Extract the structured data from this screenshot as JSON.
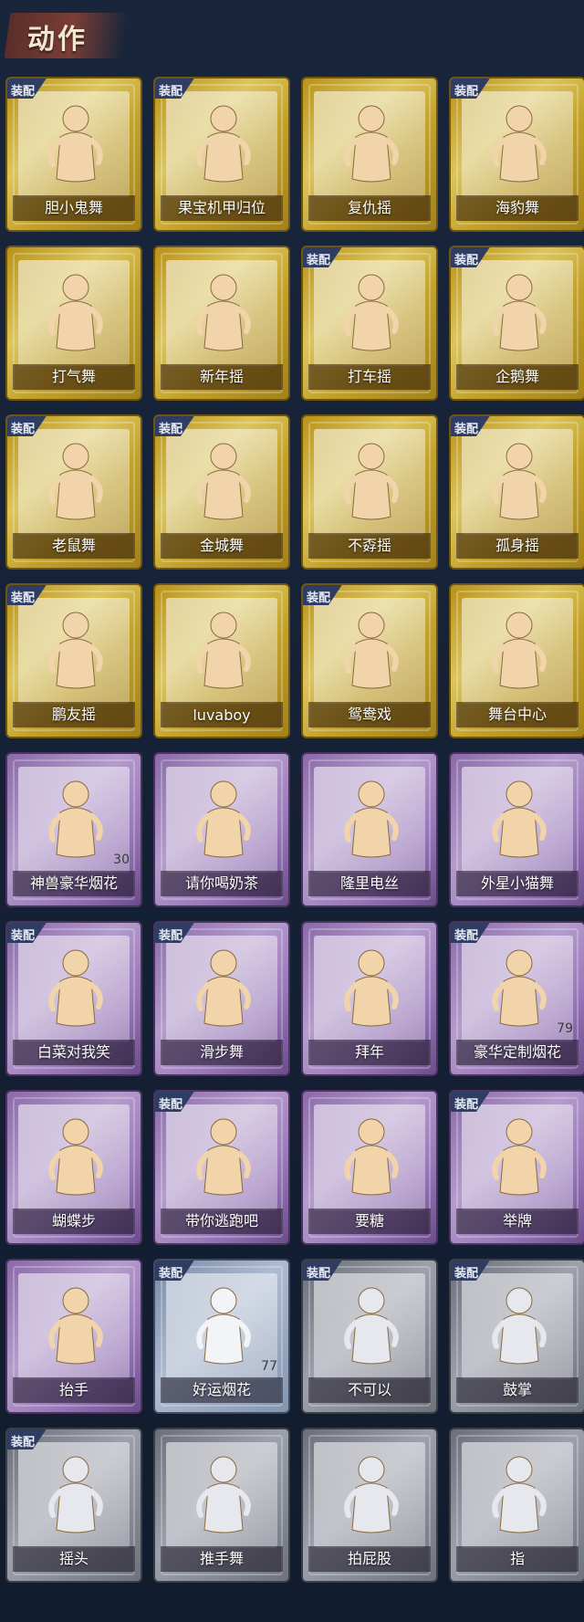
{
  "header": {
    "title": "动作"
  },
  "badge_label": "装配",
  "colors": {
    "gold": "#c9a830",
    "purple": "#a085bf",
    "blue": "#9aa8c2",
    "gray": "#8a8e98",
    "badge": "#2f3d63"
  },
  "cards": [
    {
      "label": "胆小鬼舞",
      "tier": "gold",
      "equipped": true,
      "count": ""
    },
    {
      "label": "果宝机甲归位",
      "tier": "gold",
      "equipped": true,
      "count": ""
    },
    {
      "label": "复仇摇",
      "tier": "gold",
      "equipped": false,
      "count": ""
    },
    {
      "label": "海豹舞",
      "tier": "gold",
      "equipped": true,
      "count": ""
    },
    {
      "label": "打气舞",
      "tier": "gold",
      "equipped": false,
      "count": ""
    },
    {
      "label": "新年摇",
      "tier": "gold",
      "equipped": false,
      "count": ""
    },
    {
      "label": "打车摇",
      "tier": "gold",
      "equipped": true,
      "count": ""
    },
    {
      "label": "企鹅舞",
      "tier": "gold",
      "equipped": true,
      "count": ""
    },
    {
      "label": "老鼠舞",
      "tier": "gold",
      "equipped": true,
      "count": ""
    },
    {
      "label": "金城舞",
      "tier": "gold",
      "equipped": true,
      "count": ""
    },
    {
      "label": "不孬摇",
      "tier": "gold",
      "equipped": false,
      "count": ""
    },
    {
      "label": "孤身摇",
      "tier": "gold",
      "equipped": true,
      "count": ""
    },
    {
      "label": "鹏友摇",
      "tier": "gold",
      "equipped": true,
      "count": ""
    },
    {
      "label": "luvaboy",
      "tier": "gold",
      "equipped": false,
      "count": ""
    },
    {
      "label": "鸳鸯戏",
      "tier": "gold",
      "equipped": true,
      "count": ""
    },
    {
      "label": "舞台中心",
      "tier": "gold",
      "equipped": false,
      "count": ""
    },
    {
      "label": "神兽豪华烟花",
      "tier": "purple",
      "equipped": false,
      "count": "30"
    },
    {
      "label": "请你喝奶茶",
      "tier": "purple",
      "equipped": false,
      "count": ""
    },
    {
      "label": "隆里电丝",
      "tier": "purple",
      "equipped": false,
      "count": ""
    },
    {
      "label": "外星小猫舞",
      "tier": "purple",
      "equipped": false,
      "count": ""
    },
    {
      "label": "白菜对我笑",
      "tier": "purple",
      "equipped": true,
      "count": ""
    },
    {
      "label": "滑步舞",
      "tier": "purple",
      "equipped": true,
      "count": ""
    },
    {
      "label": "拜年",
      "tier": "purple",
      "equipped": false,
      "count": ""
    },
    {
      "label": "豪华定制烟花",
      "tier": "purple",
      "equipped": true,
      "count": "79"
    },
    {
      "label": "蝴蝶步",
      "tier": "purple",
      "equipped": false,
      "count": ""
    },
    {
      "label": "带你逃跑吧",
      "tier": "purple",
      "equipped": true,
      "count": ""
    },
    {
      "label": "要糖",
      "tier": "purple",
      "equipped": false,
      "count": ""
    },
    {
      "label": "举牌",
      "tier": "purple",
      "equipped": true,
      "count": ""
    },
    {
      "label": "抬手",
      "tier": "purple",
      "equipped": false,
      "count": ""
    },
    {
      "label": "好运烟花",
      "tier": "blue",
      "equipped": true,
      "count": "77"
    },
    {
      "label": "不可以",
      "tier": "gray",
      "equipped": true,
      "count": ""
    },
    {
      "label": "鼓掌",
      "tier": "gray",
      "equipped": true,
      "count": ""
    },
    {
      "label": "摇头",
      "tier": "gray",
      "equipped": true,
      "count": ""
    },
    {
      "label": "推手舞",
      "tier": "gray",
      "equipped": false,
      "count": ""
    },
    {
      "label": "拍屁股",
      "tier": "gray",
      "equipped": false,
      "count": ""
    },
    {
      "label": "指",
      "tier": "gray",
      "equipped": false,
      "count": ""
    }
  ]
}
